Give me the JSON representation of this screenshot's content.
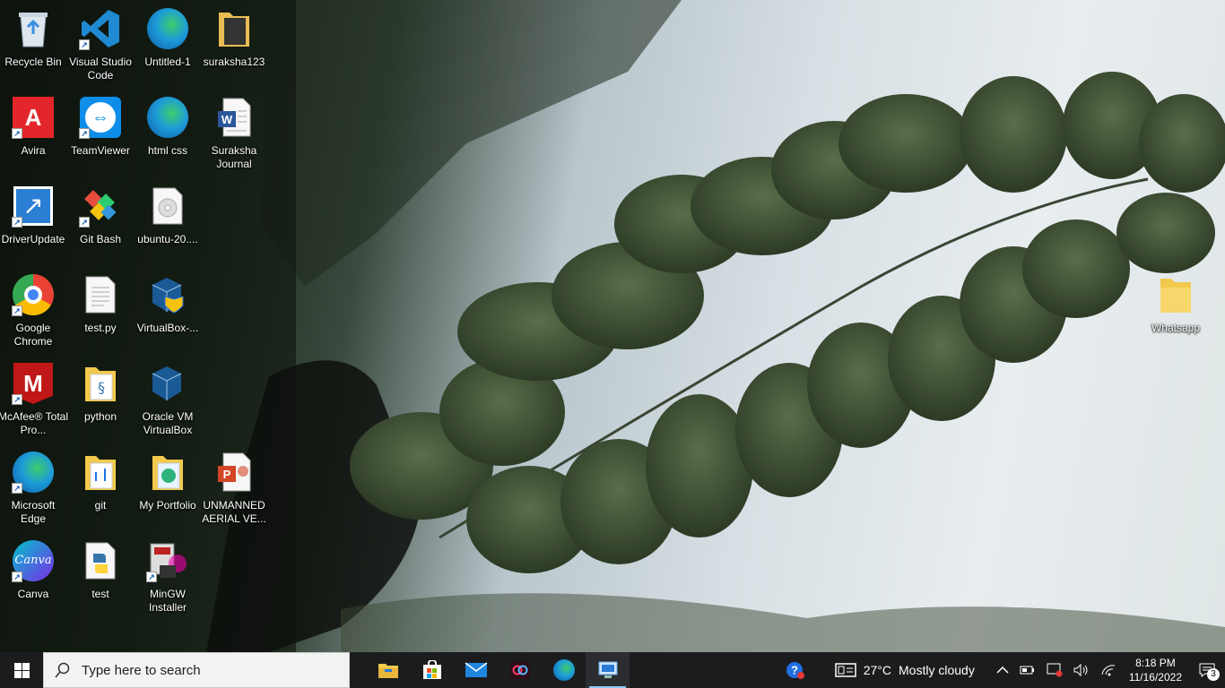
{
  "desktop": {
    "icons": [
      {
        "label": "Recycle Bin",
        "icon": "recycle-bin-icon"
      },
      {
        "label": "Visual Studio Code",
        "icon": "vscode-icon"
      },
      {
        "label": "Untitled-1",
        "icon": "edge-icon"
      },
      {
        "label": "suraksha123",
        "icon": "folder-icon"
      },
      {
        "label": "Avira",
        "icon": "avira-icon"
      },
      {
        "label": "TeamViewer",
        "icon": "teamviewer-icon"
      },
      {
        "label": "html css",
        "icon": "edge-icon"
      },
      {
        "label": "Suraksha Journal",
        "icon": "word-document-icon"
      },
      {
        "label": "DriverUpdate",
        "icon": "driverupdate-icon"
      },
      {
        "label": "Git Bash",
        "icon": "git-bash-icon"
      },
      {
        "label": "ubuntu-20....",
        "icon": "disc-image-icon"
      },
      {
        "label": "Google Chrome",
        "icon": "chrome-icon"
      },
      {
        "label": "test.py",
        "icon": "text-file-icon"
      },
      {
        "label": "VirtualBox-...",
        "icon": "virtualbox-installer-icon"
      },
      {
        "label": "McAfee® Total Pro...",
        "icon": "mcafee-icon"
      },
      {
        "label": "python",
        "icon": "python-folder-icon"
      },
      {
        "label": "Oracle VM VirtualBox",
        "icon": "virtualbox-icon"
      },
      {
        "label": "Microsoft Edge",
        "icon": "edge-icon"
      },
      {
        "label": "git",
        "icon": "folder-icon"
      },
      {
        "label": "My Portfolio",
        "icon": "folder-icon"
      },
      {
        "label": "UNMANNED AERIAL VE...",
        "icon": "powerpoint-icon"
      },
      {
        "label": "Canva",
        "icon": "canva-icon"
      },
      {
        "label": "test",
        "icon": "python-file-icon"
      },
      {
        "label": "MinGW Installer",
        "icon": "mingw-installer-icon"
      },
      {
        "label": "Whatsapp",
        "icon": "folder-icon"
      }
    ]
  },
  "taskbar": {
    "search_placeholder": "Type here to search",
    "apps": [
      "file-explorer-icon",
      "microsoft-store-icon",
      "mail-icon",
      "creative-cloud-icon",
      "edge-icon",
      "remote-desktop-icon"
    ],
    "weather": {
      "temp": "27°C",
      "condition": "Mostly cloudy"
    },
    "clock": {
      "time": "8:18 PM",
      "date": "11/16/2022"
    },
    "notifications": "3"
  }
}
